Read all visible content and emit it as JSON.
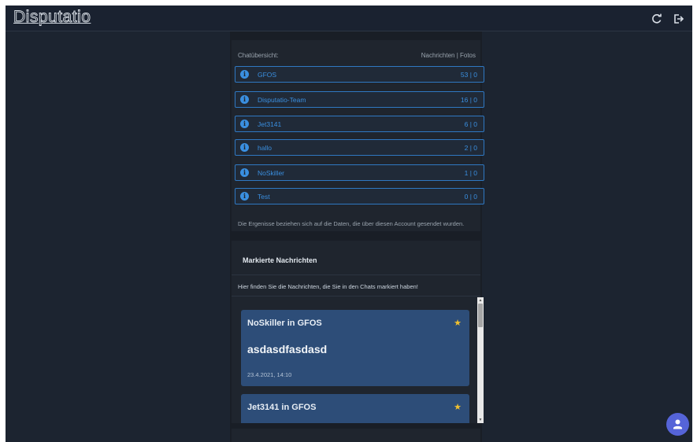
{
  "app": {
    "title": "Disputatio"
  },
  "overview": {
    "header_left": "Chatübersicht:",
    "header_right": "Nachrichten | Fotos",
    "chats": [
      {
        "name": "GFOS",
        "counts": "53 | 0"
      },
      {
        "name": "Disputatio-Team",
        "counts": "16 | 0"
      },
      {
        "name": "Jet3141",
        "counts": "6 | 0"
      },
      {
        "name": "hallo",
        "counts": "2 | 0"
      },
      {
        "name": "NoSkiller",
        "counts": "1 | 0"
      },
      {
        "name": "Test",
        "counts": "0 | 0"
      }
    ],
    "note": "Die Ergenisse beziehen sich auf die Daten, die über diesen Account gesendet wurden."
  },
  "marked": {
    "title": "Markierte Nachrichten",
    "subtitle": "Hier finden Sie die Nachrichten, die Sie in den Chats markiert haben!",
    "messages": [
      {
        "header": "NoSkiller in GFOS",
        "text": "asdasdfasdasd",
        "time": "23.4.2021, 14:10"
      },
      {
        "header": "Jet3141 in GFOS",
        "text": "",
        "time": ""
      }
    ]
  },
  "icons": {
    "refresh": "refresh-icon",
    "logout": "logout-icon",
    "info": "info-icon",
    "star": "star-icon",
    "user": "user-icon"
  },
  "colors": {
    "accent": "#3a8fe0",
    "message_card": "#2d4d78",
    "star": "#f2c12e",
    "fab": "#5564d8"
  }
}
